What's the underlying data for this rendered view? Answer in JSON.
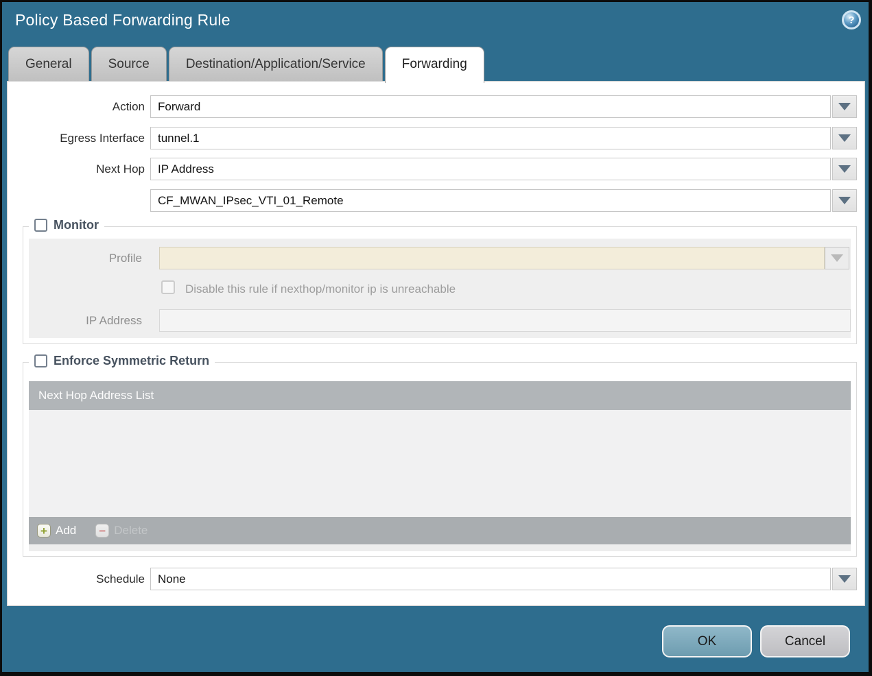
{
  "window": {
    "title": "Policy Based Forwarding Rule"
  },
  "icons": {
    "help": "?",
    "add": "+",
    "delete": "−",
    "dropdown": "triangle-down"
  },
  "tabs": [
    {
      "label": "General",
      "active": false
    },
    {
      "label": "Source",
      "active": false
    },
    {
      "label": "Destination/Application/Service",
      "active": false
    },
    {
      "label": "Forwarding",
      "active": true
    }
  ],
  "form": {
    "action": {
      "label": "Action",
      "value": "Forward"
    },
    "egress_interface": {
      "label": "Egress Interface",
      "value": "tunnel.1"
    },
    "next_hop": {
      "label": "Next Hop",
      "value": "IP Address",
      "address_value": "CF_MWAN_IPsec_VTI_01_Remote"
    },
    "monitor": {
      "label": "Monitor",
      "checked": false,
      "profile": {
        "label": "Profile",
        "value": ""
      },
      "disable_rule": {
        "label": "Disable this rule if nexthop/monitor ip is unreachable",
        "checked": false
      },
      "ip_address": {
        "label": "IP Address",
        "value": ""
      }
    },
    "enforce_symmetric_return": {
      "label": "Enforce Symmetric Return",
      "checked": false,
      "table": {
        "header": "Next Hop Address List",
        "rows": []
      },
      "add_label": "Add",
      "delete_label": "Delete"
    },
    "schedule": {
      "label": "Schedule",
      "value": "None"
    }
  },
  "footer": {
    "ok": "OK",
    "cancel": "Cancel"
  },
  "colors": {
    "titlebar_teal": "#2e6d8e",
    "tab_gray": "#c6c6c6",
    "active_tab_white": "#ffffff",
    "table_header_gray": "#b1b5b8",
    "table_footer_gray": "#a9adb0",
    "disabled_field_beige": "#f3edda",
    "ok_button_teal": "#74a6bb",
    "cancel_button_gray": "#c9c9cd",
    "add_plus_green": "#8fa030",
    "delete_minus_red": "#d08484"
  }
}
